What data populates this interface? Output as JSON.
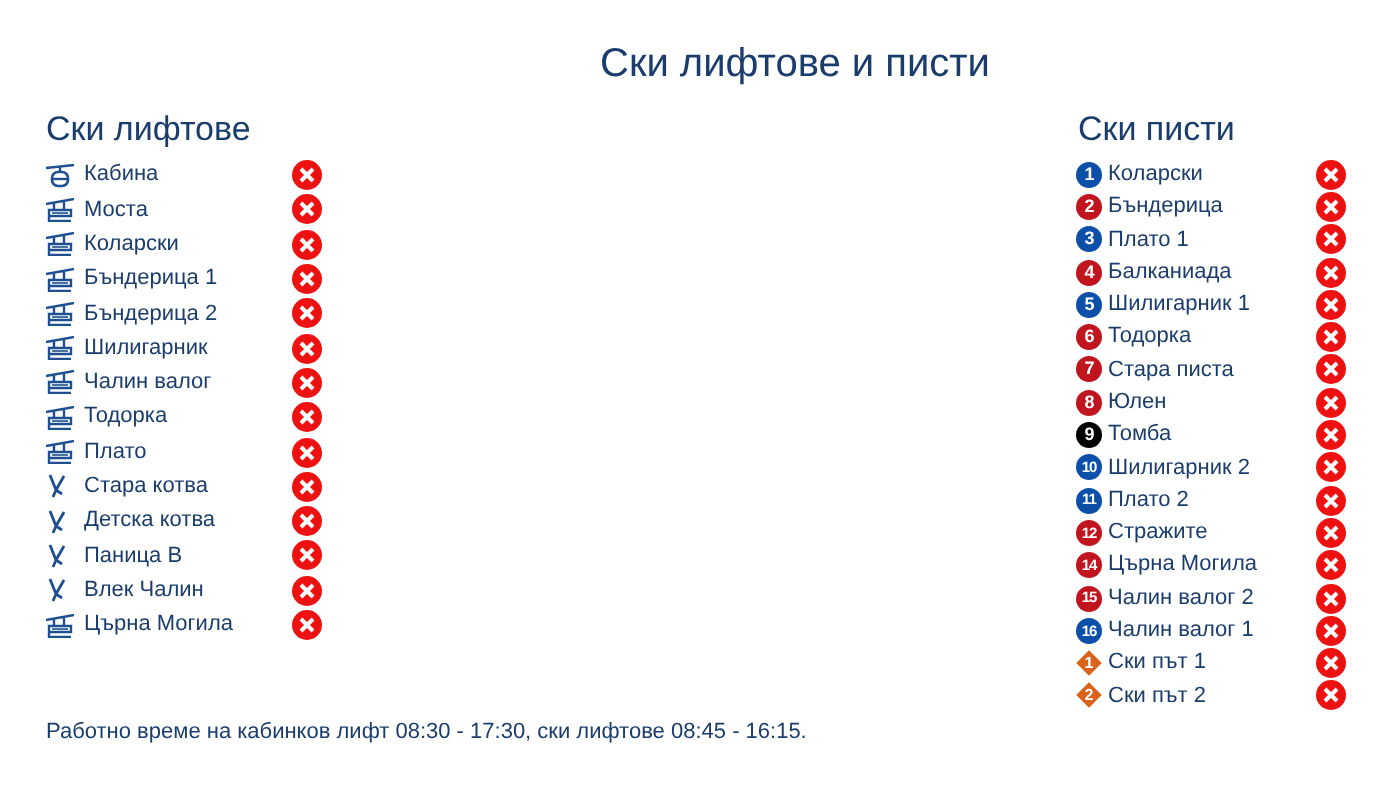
{
  "title": "Ски лифтове и писти",
  "lifts": {
    "heading": "Ски лифтове",
    "items": [
      {
        "name": "Кабина",
        "kind": "cabin",
        "open": false
      },
      {
        "name": "Моста",
        "kind": "chair",
        "open": false
      },
      {
        "name": "Коларски",
        "kind": "chair",
        "open": false
      },
      {
        "name": "Бъндерица 1",
        "kind": "chair",
        "open": false
      },
      {
        "name": "Бъндерица 2",
        "kind": "chair",
        "open": false
      },
      {
        "name": "Шилигарник",
        "kind": "chair",
        "open": false
      },
      {
        "name": "Чалин валог",
        "kind": "chair",
        "open": false
      },
      {
        "name": "Тодорка",
        "kind": "chair",
        "open": false
      },
      {
        "name": "Плато",
        "kind": "chair",
        "open": false
      },
      {
        "name": "Стара котва",
        "kind": "drag",
        "open": false
      },
      {
        "name": "Детска котва",
        "kind": "drag",
        "open": false
      },
      {
        "name": "Паница В",
        "kind": "drag",
        "open": false
      },
      {
        "name": "Влек Чалин",
        "kind": "drag",
        "open": false
      },
      {
        "name": "Църна Могила",
        "kind": "chair",
        "open": false
      }
    ]
  },
  "pistes": {
    "heading": "Ски писти",
    "items": [
      {
        "number": "1",
        "name": "Коларски",
        "kind": "circle",
        "color": "#0b4fa8",
        "open": false
      },
      {
        "number": "2",
        "name": "Бъндерица",
        "kind": "circle",
        "color": "#c0141e",
        "open": false
      },
      {
        "number": "3",
        "name": "Плато 1",
        "kind": "circle",
        "color": "#0b4fa8",
        "open": false
      },
      {
        "number": "4",
        "name": "Балканиада",
        "kind": "circle",
        "color": "#c0141e",
        "open": false
      },
      {
        "number": "5",
        "name": "Шилигарник 1",
        "kind": "circle",
        "color": "#0b4fa8",
        "open": false
      },
      {
        "number": "6",
        "name": "Тодорка",
        "kind": "circle",
        "color": "#c0141e",
        "open": false
      },
      {
        "number": "7",
        "name": "Стара писта",
        "kind": "circle",
        "color": "#c0141e",
        "open": false
      },
      {
        "number": "8",
        "name": "Юлен",
        "kind": "circle",
        "color": "#c0141e",
        "open": false
      },
      {
        "number": "9",
        "name": "Томба",
        "kind": "circle",
        "color": "#000000",
        "open": false
      },
      {
        "number": "10",
        "name": "Шилигарник 2",
        "kind": "circle",
        "color": "#0b4fa8",
        "open": false
      },
      {
        "number": "11",
        "name": "Плато 2",
        "kind": "circle",
        "color": "#0b4fa8",
        "open": false
      },
      {
        "number": "12",
        "name": "Стражите",
        "kind": "circle",
        "color": "#c0141e",
        "open": false
      },
      {
        "number": "14",
        "name": "Църна Могила",
        "kind": "circle",
        "color": "#c0141e",
        "open": false
      },
      {
        "number": "15",
        "name": "Чалин валог 2",
        "kind": "circle",
        "color": "#c0141e",
        "open": false
      },
      {
        "number": "16",
        "name": "Чалин валог 1",
        "kind": "circle",
        "color": "#0b4fa8",
        "open": false
      },
      {
        "number": "1",
        "name": "Ски път 1",
        "kind": "diamond",
        "color": "#d9631a",
        "open": false
      },
      {
        "number": "2",
        "name": "Ски път 2",
        "kind": "diamond",
        "color": "#d9631a",
        "open": false
      }
    ]
  },
  "footer": "Работно време на кабинков лифт 08:30 - 17:30, ски лифтове 08:45 - 16:15."
}
